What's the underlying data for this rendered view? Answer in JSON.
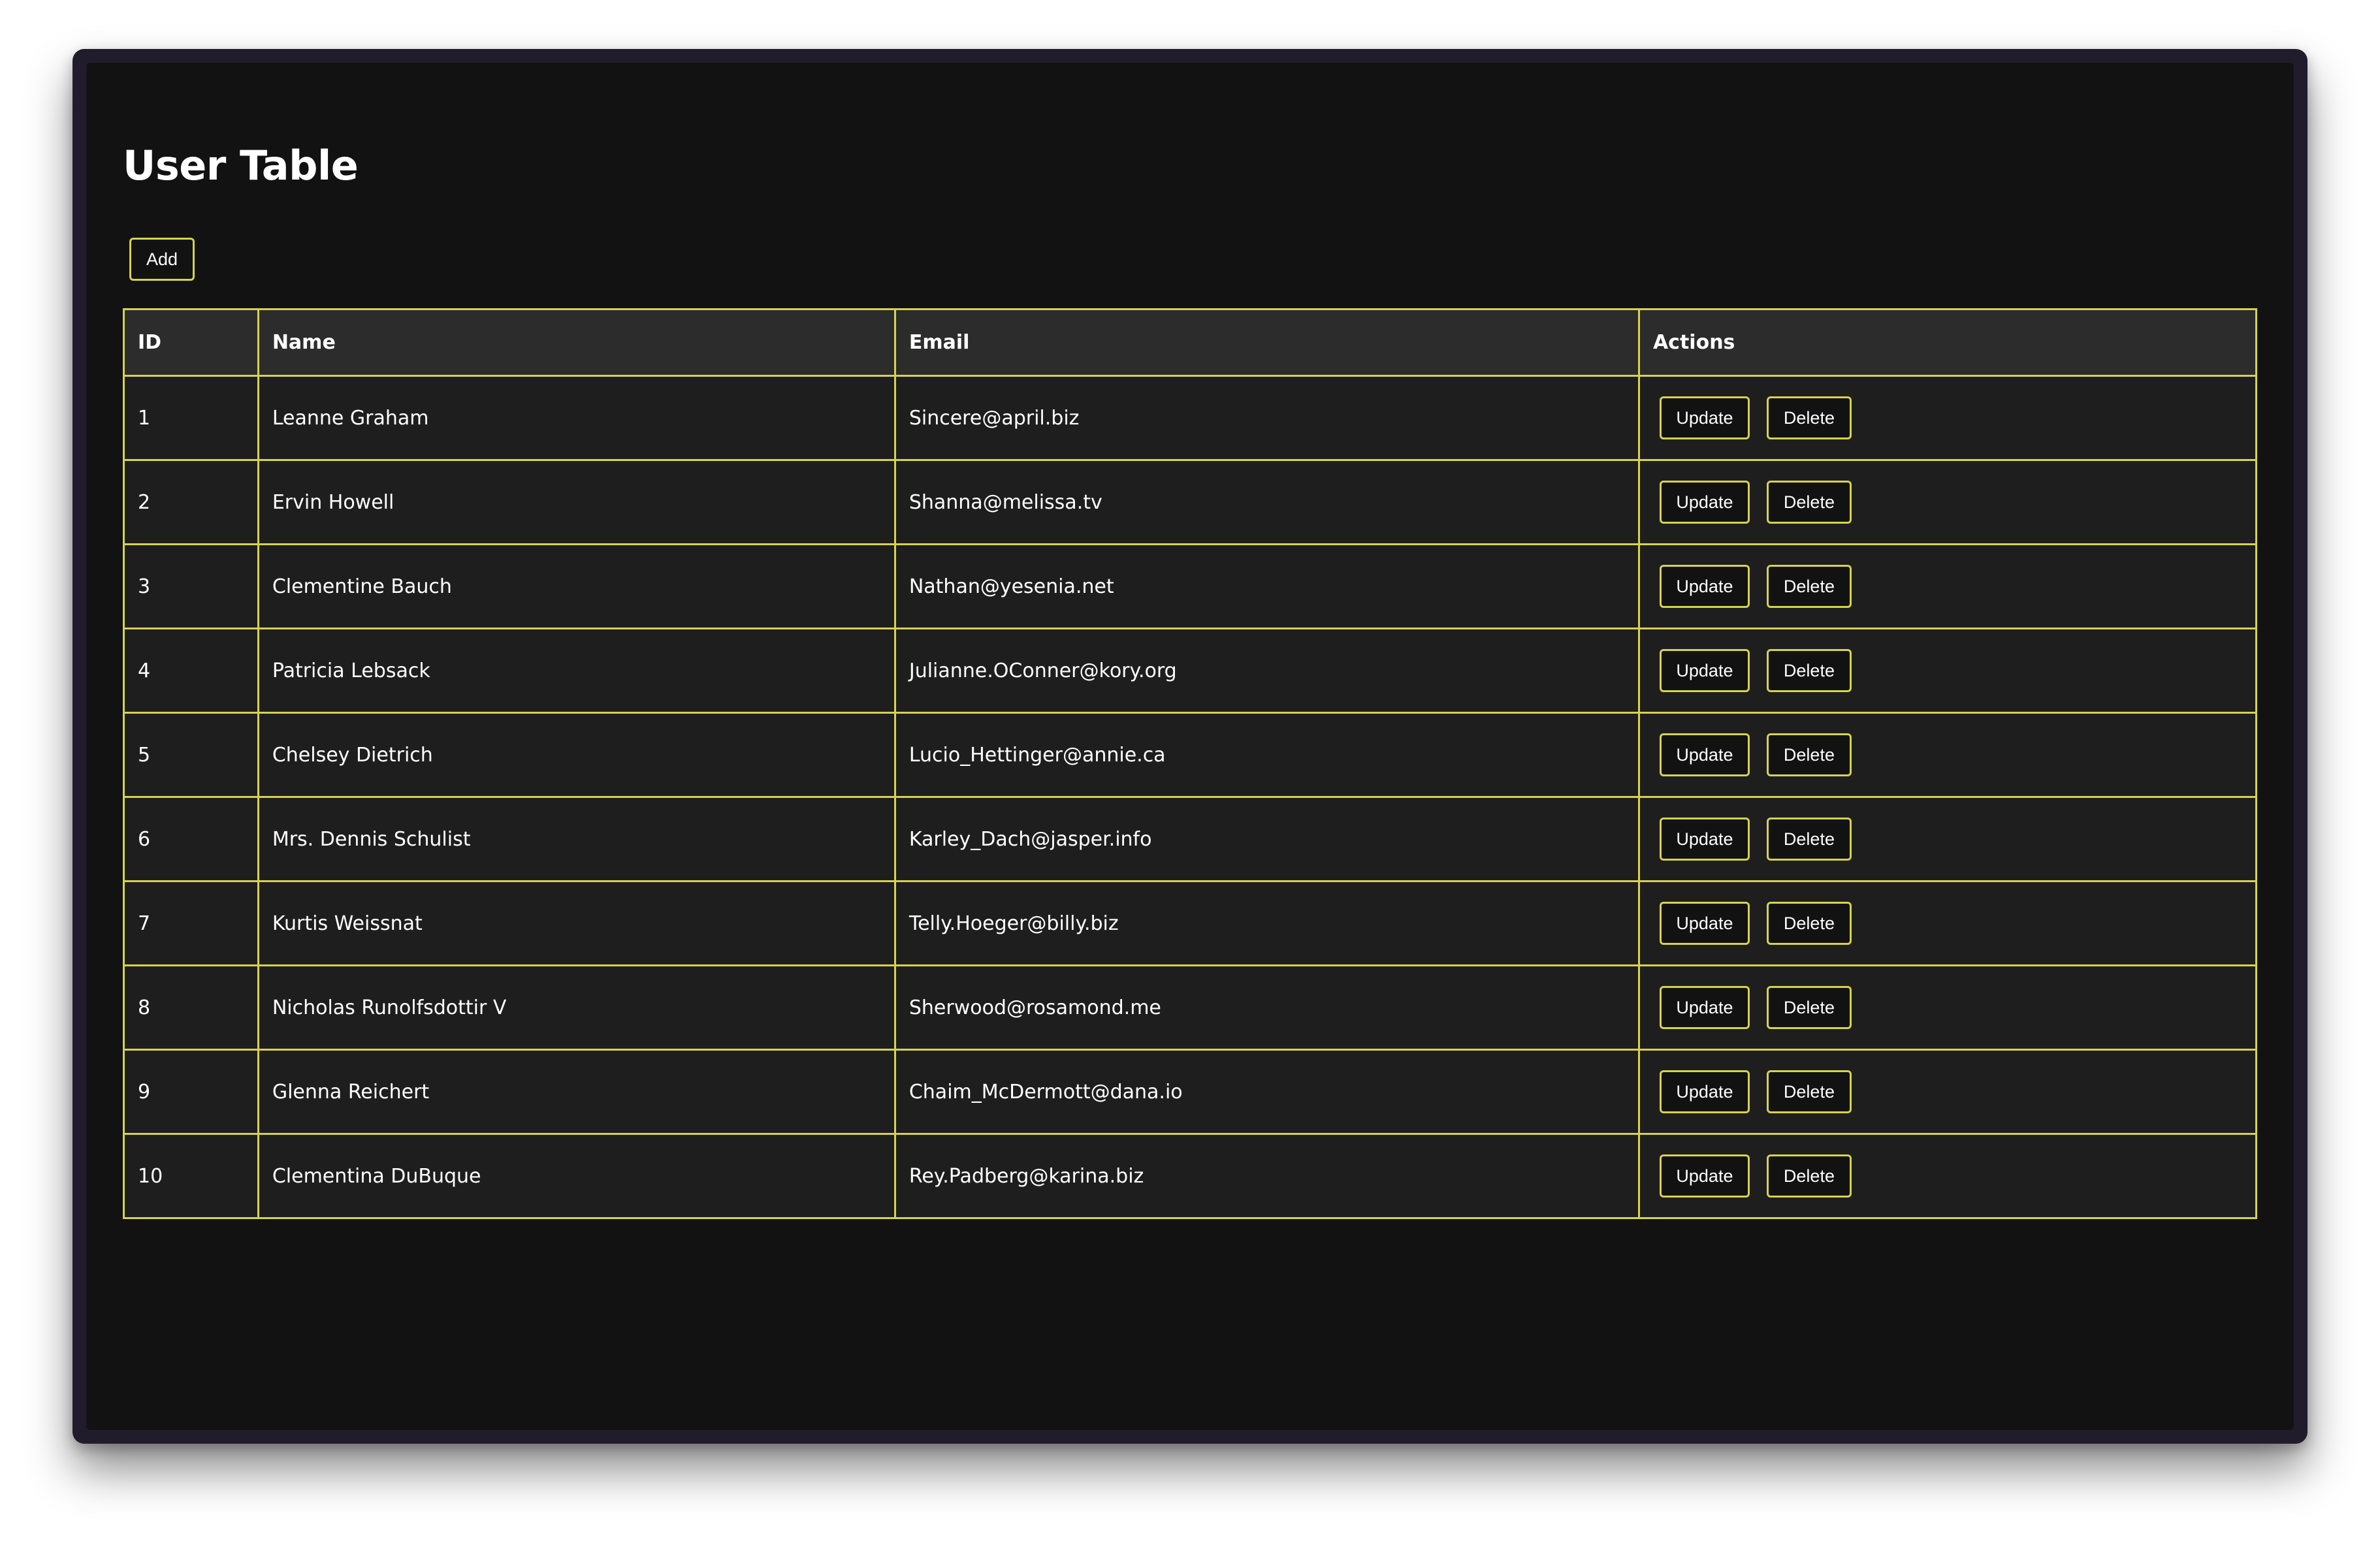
{
  "page": {
    "title": "User Table"
  },
  "toolbar": {
    "add_label": "Add"
  },
  "table": {
    "headers": {
      "id": "ID",
      "name": "Name",
      "email": "Email",
      "actions": "Actions"
    },
    "rows": [
      {
        "id": "1",
        "name": "Leanne Graham",
        "email": "Sincere@april.biz"
      },
      {
        "id": "2",
        "name": "Ervin Howell",
        "email": "Shanna@melissa.tv"
      },
      {
        "id": "3",
        "name": "Clementine Bauch",
        "email": "Nathan@yesenia.net"
      },
      {
        "id": "4",
        "name": "Patricia Lebsack",
        "email": "Julianne.OConner@kory.org"
      },
      {
        "id": "5",
        "name": "Chelsey Dietrich",
        "email": "Lucio_Hettinger@annie.ca"
      },
      {
        "id": "6",
        "name": "Mrs. Dennis Schulist",
        "email": "Karley_Dach@jasper.info"
      },
      {
        "id": "7",
        "name": "Kurtis Weissnat",
        "email": "Telly.Hoeger@billy.biz"
      },
      {
        "id": "8",
        "name": "Nicholas Runolfsdottir V",
        "email": "Sherwood@rosamond.me"
      },
      {
        "id": "9",
        "name": "Glenna Reichert",
        "email": "Chaim_McDermott@dana.io"
      },
      {
        "id": "10",
        "name": "Clementina DuBuque",
        "email": "Rey.Padberg@karina.biz"
      }
    ],
    "update_label": "Update",
    "delete_label": "Delete"
  },
  "colors": {
    "accent_border": "#d6d34e",
    "background": "#121212",
    "row_background": "#1e1e1e",
    "header_background": "#2c2c2c",
    "text": "#ffffff"
  }
}
